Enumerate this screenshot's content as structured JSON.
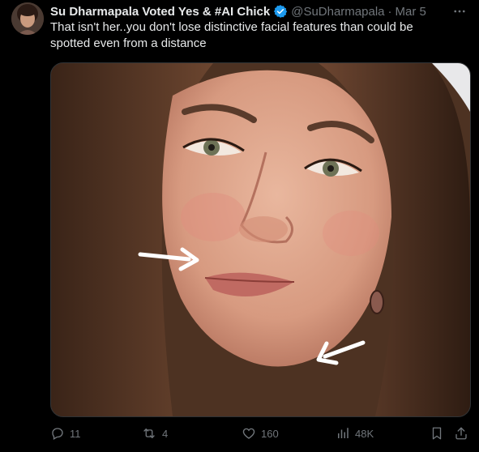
{
  "tweet": {
    "author_name": "Su Dharmapala Voted Yes & #AI Chick",
    "handle": "@SuDharmapala",
    "separator": "·",
    "date": "Mar 5",
    "text": "That isn't her..you don't lose distinctive facial features than could be spotted even from a distance"
  },
  "actions": {
    "replies": "11",
    "reposts": "4",
    "likes": "160",
    "views": "48K"
  },
  "colors": {
    "background": "#000000",
    "text": "#e7e9ea",
    "muted": "#71767b",
    "verified": "#1d9bf0"
  },
  "icons": [
    "verified-badge-icon",
    "more-icon",
    "reply-icon",
    "repost-icon",
    "like-icon",
    "views-icon",
    "bookmark-icon",
    "share-icon"
  ]
}
